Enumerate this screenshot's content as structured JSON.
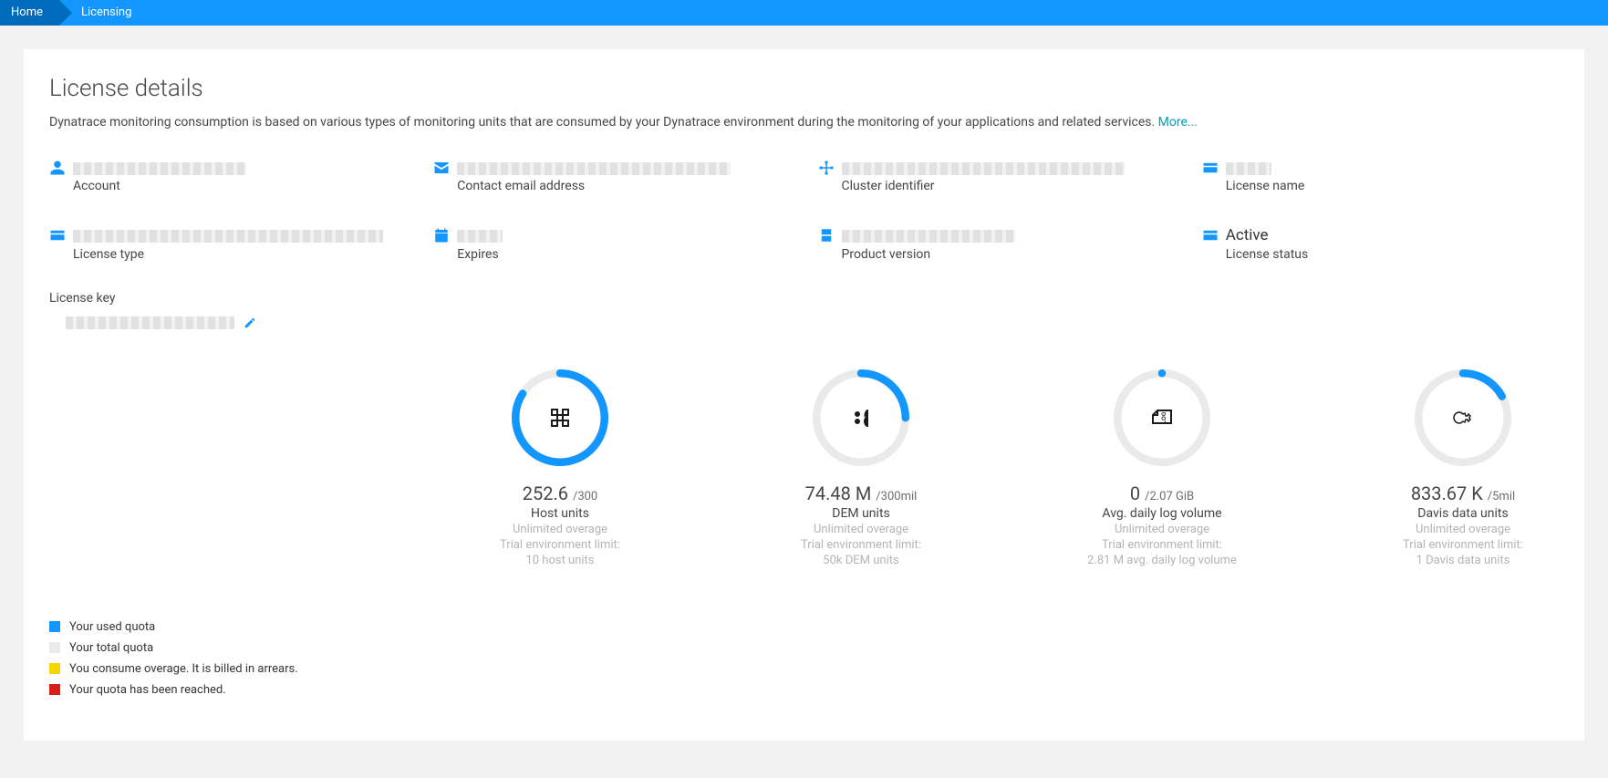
{
  "breadcrumbs": {
    "home": "Home",
    "licensing": "Licensing"
  },
  "page": {
    "title": "License details",
    "desc": "Dynatrace monitoring consumption is based on various types of monitoring units that are consumed by your Dynatrace environment during the monitoring of your applications and related services.",
    "more": "More..."
  },
  "colors": {
    "used": "#1496ff",
    "total": "#eaeaea",
    "overage": "#f6d400",
    "reached": "#d91e18"
  },
  "info": {
    "account": {
      "label": "Account",
      "redactedW": 190
    },
    "contact": {
      "label": "Contact email address",
      "redactedW": 300
    },
    "cluster": {
      "label": "Cluster identifier",
      "redactedW": 310
    },
    "license_name": {
      "label": "License name",
      "redactedW": 50
    },
    "license_type": {
      "label": "License type",
      "redactedW": 340
    },
    "expires": {
      "label": "Expires",
      "redactedW": 50
    },
    "product": {
      "label": "Product version",
      "redactedW": 190
    },
    "status": {
      "label": "License status",
      "value": "Active"
    }
  },
  "key": {
    "label": "License key",
    "redactedW": 185
  },
  "gauges": [
    {
      "id": "host-units",
      "icon": "fullstack",
      "value": "252.6",
      "suffix": "/300",
      "label": "Host units",
      "overage": "Unlimited overage",
      "trial_line": "Trial environment limit:",
      "trial_value": "10 host units",
      "pct": 84
    },
    {
      "id": "dem-units",
      "icon": "users",
      "value": "74.48 M",
      "suffix": "/300mil",
      "label": "DEM units",
      "overage": "Unlimited overage",
      "trial_line": "Trial environment limit:",
      "trial_value": "50k DEM units",
      "pct": 25
    },
    {
      "id": "log-volume",
      "icon": "log",
      "value": "0",
      "suffix": "/2.07 GiB",
      "label": "Avg. daily log volume",
      "overage": "Unlimited overage",
      "trial_line": "Trial environment limit:",
      "trial_value": "2.81 M avg. daily log volume",
      "pct": 0
    },
    {
      "id": "davis-units",
      "icon": "davis",
      "value": "833.67 K",
      "suffix": "/5mil",
      "label": "Davis data units",
      "overage": "Unlimited overage",
      "trial_line": "Trial environment limit:",
      "trial_value": "1 Davis data units",
      "pct": 17
    }
  ],
  "legend": [
    {
      "colorKey": "used",
      "text": "Your used quota"
    },
    {
      "colorKey": "total",
      "text": "Your total quota"
    },
    {
      "colorKey": "overage",
      "text": "You consume overage. It is billed in arrears."
    },
    {
      "colorKey": "reached",
      "text": "Your quota has been reached."
    }
  ]
}
